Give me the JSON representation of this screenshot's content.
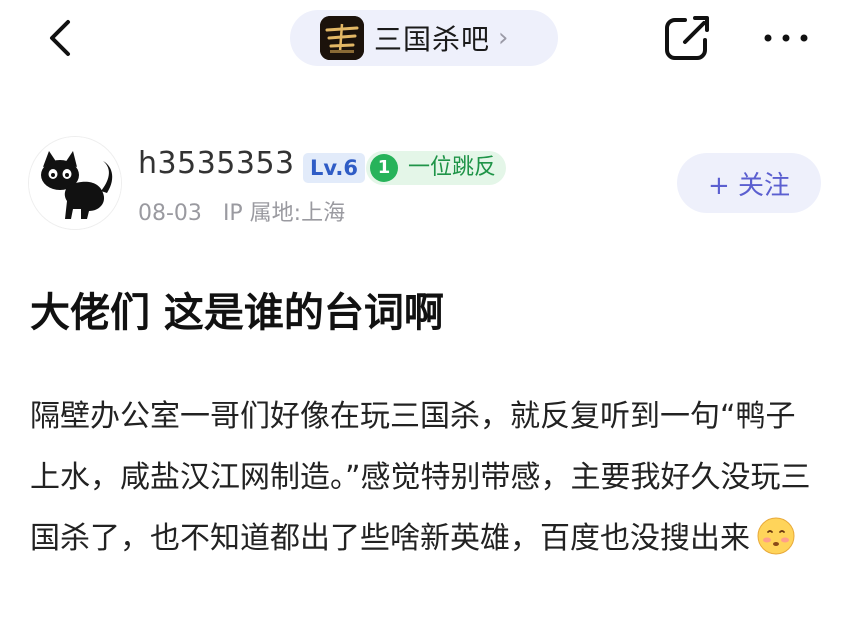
{
  "nav": {
    "forum_name": "三国杀吧",
    "forum_arrow": "›",
    "more_label": "···",
    "back_icon": "chevron-left-icon",
    "edit_icon": "edit-icon"
  },
  "author": {
    "username": "h3535353",
    "level": "Lv.6",
    "fan_rank": "1",
    "fan_label": "一位跳反",
    "date": "08-03",
    "ip_location": "IP 属地:上海",
    "follow_label": "+ 关注"
  },
  "post": {
    "title": "大佬们 这是谁的台词啊",
    "body": "隔壁办公室一哥们好像在玩三国杀，就反复听到一句“鸭子上水，咸盐汉江网制造。”感觉特别带感，主要我好久没玩三国杀了，也不知道都出了些啥新英雄，百度也没搜出来",
    "end_emoji": "shy-face-emoji"
  },
  "colors": {
    "pill_bg": "#eef0fb",
    "follow_text": "#5b5fd0",
    "level_text": "#2f5cc6",
    "fan_green": "#27b35a"
  }
}
